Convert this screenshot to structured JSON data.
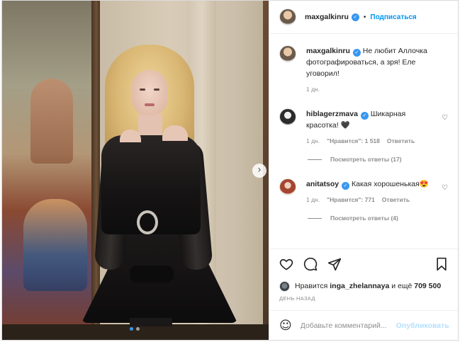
{
  "post": {
    "username": "maxgalkinru",
    "separator": "•",
    "follow_label": "Подписаться",
    "verified_glyph": "✓",
    "nav_next_glyph": "›",
    "carousel": {
      "slides": 2,
      "active_index": 0
    }
  },
  "caption": {
    "username": "maxgalkinru",
    "text": "Не любит Аллочка фотографироваться, а зря! Еле уговорил!",
    "time": "1 дн."
  },
  "comments": [
    {
      "username": "hiblagerzmava",
      "text": "Шикарная красотка! 🖤",
      "time": "1 дн.",
      "likes": "\"Нравится\": 1 518",
      "reply_label": "Ответить",
      "view_replies": "Посмотреть ответы (17)"
    },
    {
      "username": "anitatsoy",
      "text": "Какая хорошенькая😍",
      "time": "1 дн.",
      "likes": "\"Нравится\": 771",
      "reply_label": "Ответить",
      "view_replies": "Посмотреть ответы (4)"
    }
  ],
  "likes": {
    "prefix": "Нравится",
    "user": "inga_zhelannaya",
    "suffix": "и ещё",
    "count": "709 500"
  },
  "date_label": "ДЕНЬ НАЗАД",
  "add_comment": {
    "placeholder": "Добавьте комментарий...",
    "post_label": "Опубликовать",
    "emoji_glyph": "☺"
  },
  "icons": {
    "heart": "heart-icon",
    "comment": "comment-icon",
    "share": "share-icon",
    "save": "bookmark-icon"
  },
  "colors": {
    "accent": "#0095f6",
    "verified": "#3897f0",
    "muted": "#8e8e8e",
    "disabled_post": "#b2dffc"
  }
}
